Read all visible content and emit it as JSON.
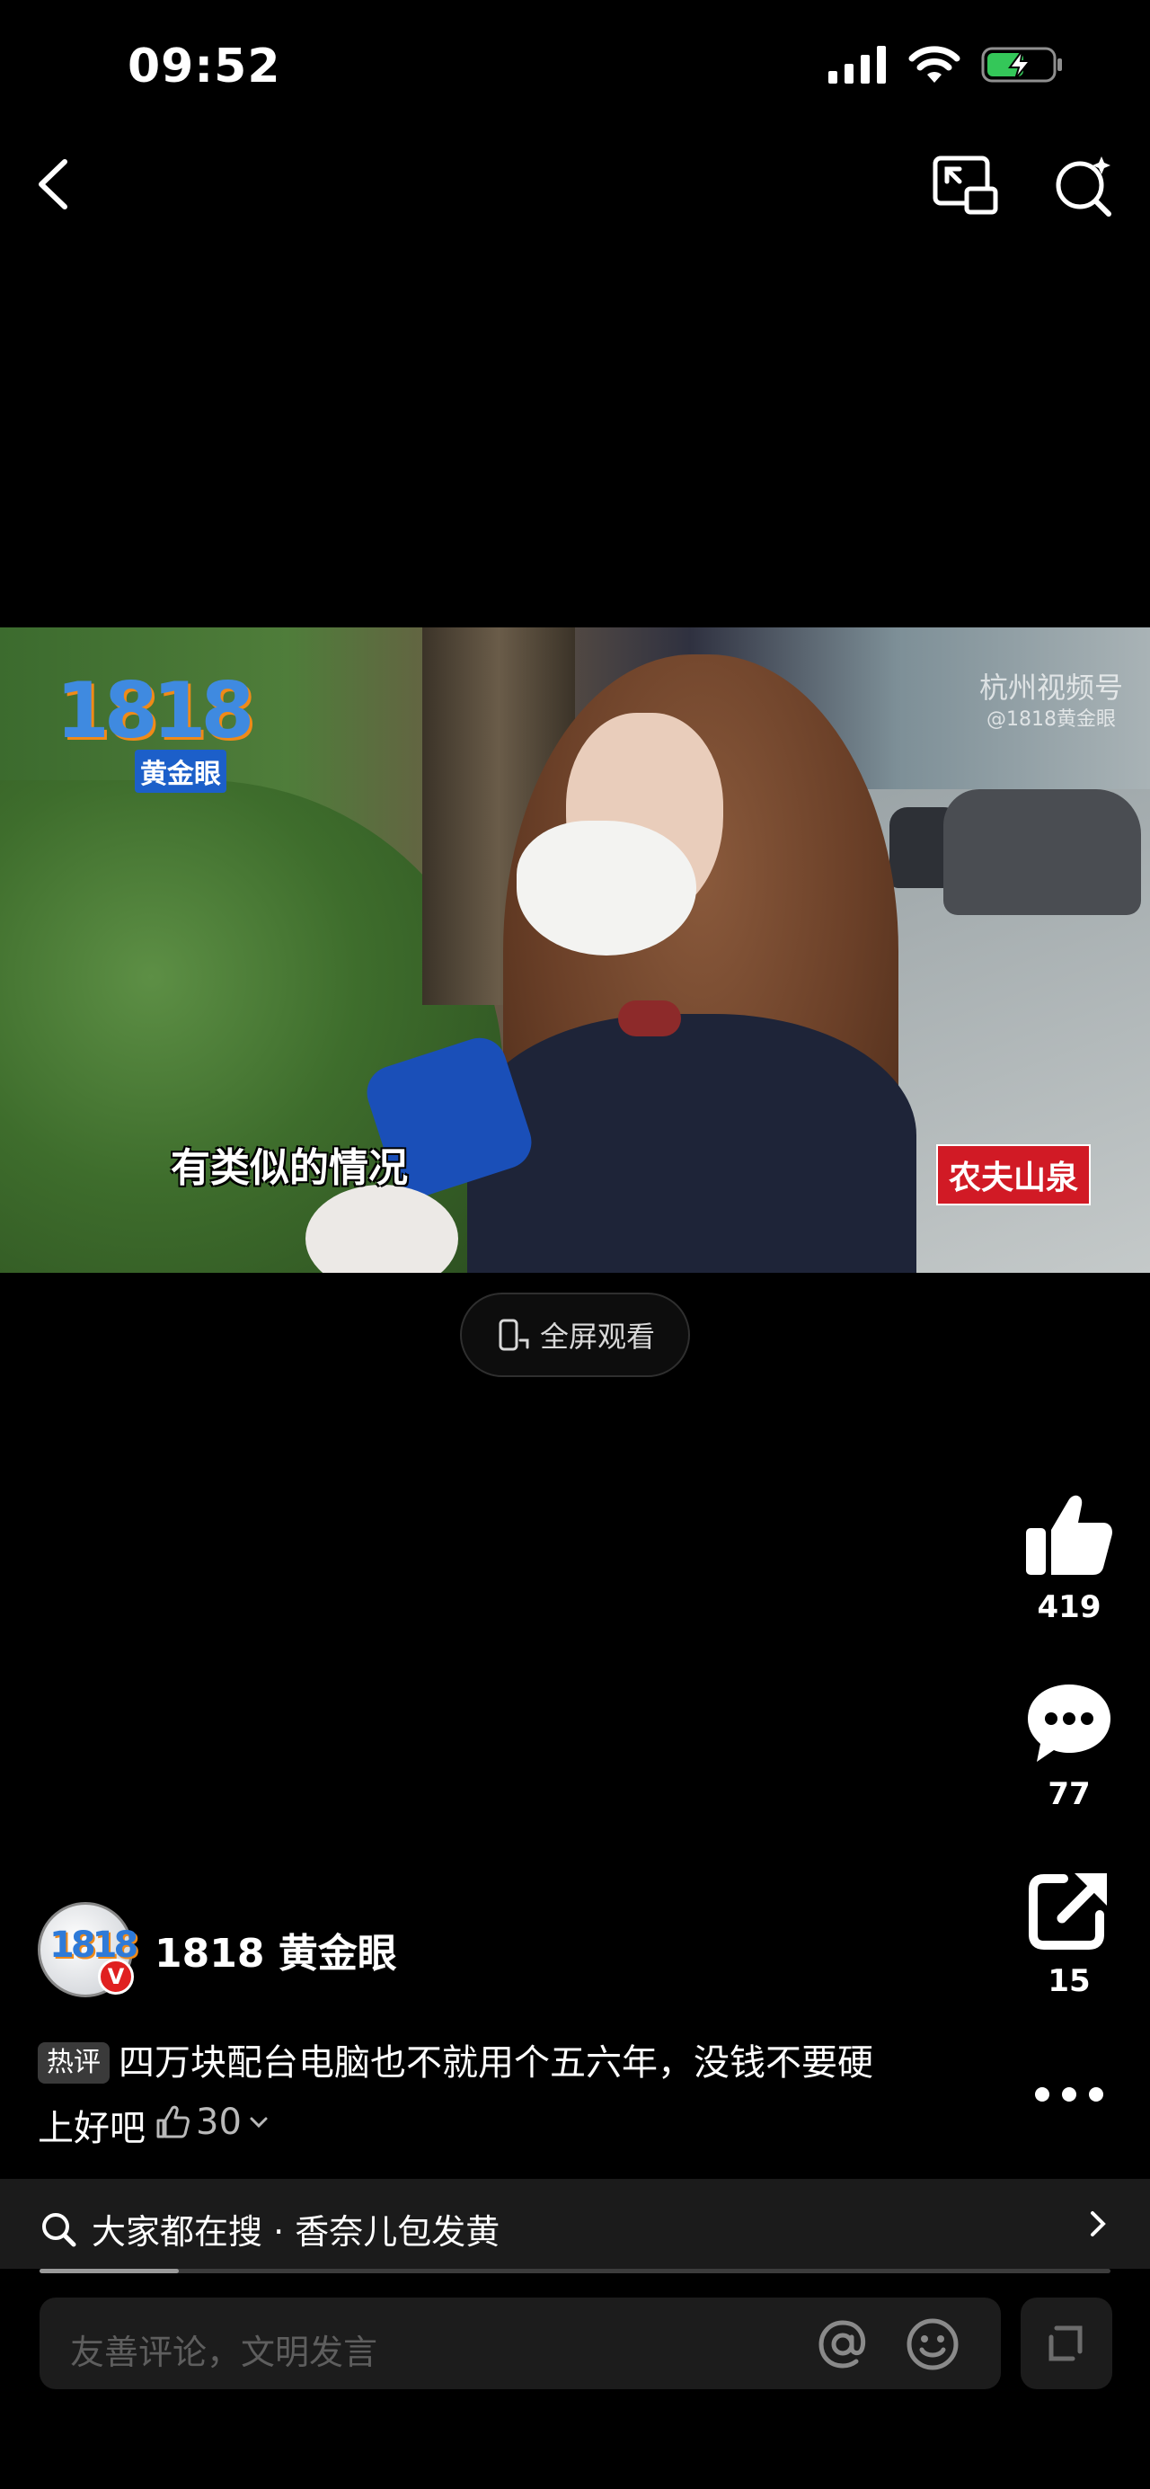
{
  "status_bar": {
    "time": "09:52"
  },
  "video": {
    "logo_number": "1818",
    "logo_name": "黄金眼",
    "watermark": "杭州视频号",
    "watermark_sub": "@1818黄金眼",
    "subtitle": "有类似的情况",
    "sponsor": "农夫山泉"
  },
  "fullscreen_label": "全屏观看",
  "actions": {
    "likes": "419",
    "comments": "77",
    "shares": "15"
  },
  "author": {
    "avatar_text": "1818",
    "name": "1818 黄金眼",
    "verified_mark": "V"
  },
  "hot_comment": {
    "badge": "热评",
    "text": "四万块配台电脑也不就用个五六年，没钱不要硬上好吧",
    "like_count": "30"
  },
  "search_suggestion": {
    "label": "大家都在搜 · 香奈儿包发黄",
    "progress": 0.13
  },
  "comment_input": {
    "placeholder": "友善评论，文明发言"
  }
}
